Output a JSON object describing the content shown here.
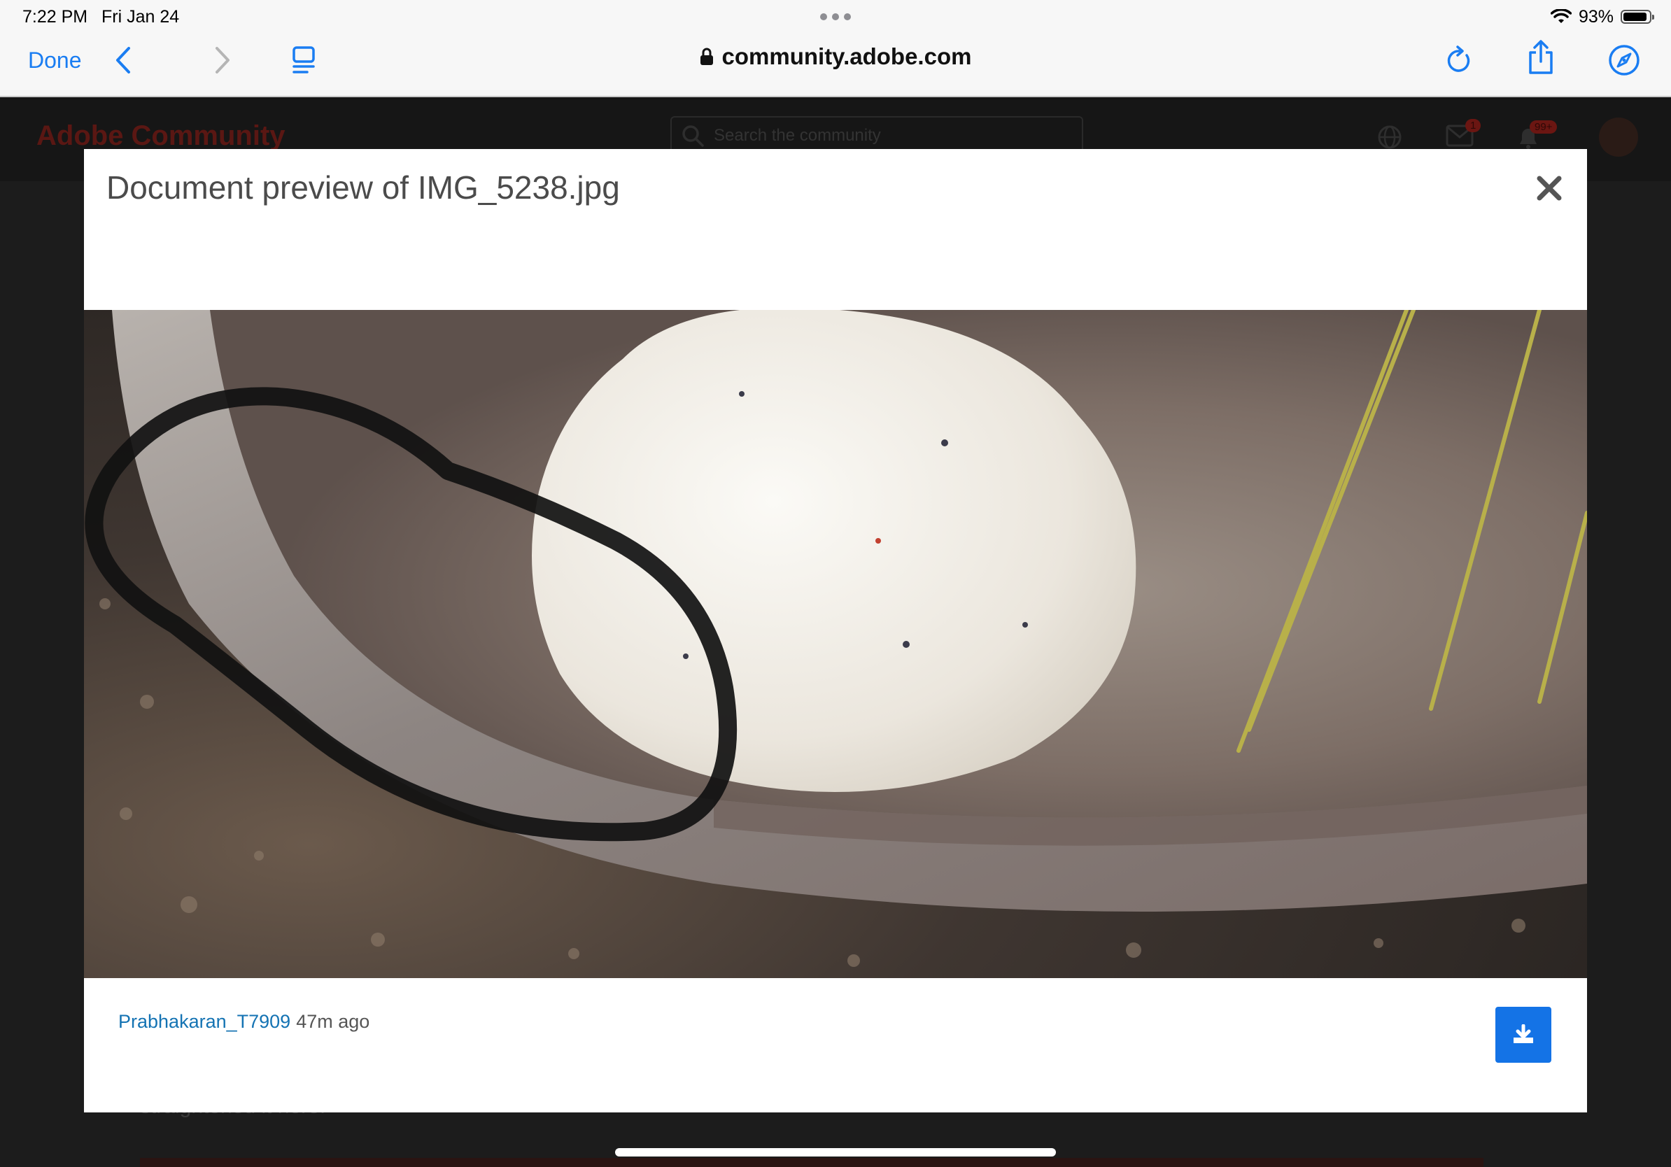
{
  "status_bar": {
    "time": "7:22 PM",
    "date": "Fri Jan 24",
    "battery_percent": "93%",
    "battery_level": 0.93
  },
  "browser": {
    "done_label": "Done",
    "url": "community.adobe.com",
    "accent_color": "#1a7df2",
    "icons": [
      "back-icon",
      "forward-icon",
      "reader-icon",
      "lock-icon",
      "reload-icon",
      "share-icon",
      "compass-icon"
    ]
  },
  "background_page": {
    "brand": "Adobe Community",
    "search_placeholder": "Search the community",
    "mail_badge": "1",
    "notification_badge": "99+",
    "partial_text": "straightened it here."
  },
  "modal": {
    "title": "Document preview of IMG_5238.jpg",
    "author": "Prabhakaran_T7909",
    "time_ago": "47m ago",
    "download_color": "#1473e6",
    "link_color": "#1473b3"
  }
}
